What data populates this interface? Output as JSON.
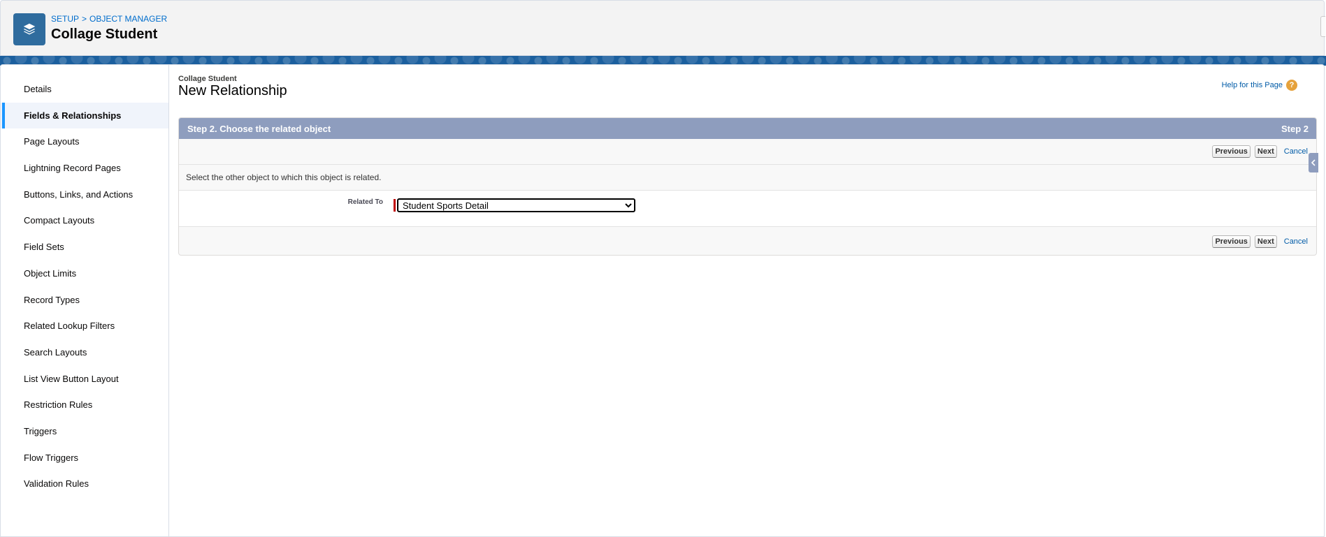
{
  "header": {
    "breadcrumb": [
      {
        "label": "SETUP"
      },
      {
        "label": "OBJECT MANAGER"
      }
    ],
    "breadcrumb_separator": ">",
    "title": "Collage Student",
    "icon": "stacked-layers-icon"
  },
  "sidebar": {
    "active_index": 1,
    "items": [
      {
        "label": "Details"
      },
      {
        "label": "Fields & Relationships"
      },
      {
        "label": "Page Layouts"
      },
      {
        "label": "Lightning Record Pages"
      },
      {
        "label": "Buttons, Links, and Actions"
      },
      {
        "label": "Compact Layouts"
      },
      {
        "label": "Field Sets"
      },
      {
        "label": "Object Limits"
      },
      {
        "label": "Record Types"
      },
      {
        "label": "Related Lookup Filters"
      },
      {
        "label": "Search Layouts"
      },
      {
        "label": "List View Button Layout"
      },
      {
        "label": "Restriction Rules"
      },
      {
        "label": "Triggers"
      },
      {
        "label": "Flow Triggers"
      },
      {
        "label": "Validation Rules"
      }
    ]
  },
  "main": {
    "object_label": "Collage Student",
    "page_title": "New Relationship",
    "help_link": "Help for this Page",
    "help_icon": "?",
    "step": {
      "title": "Step 2. Choose the related object",
      "step_indicator": "Step 2"
    },
    "buttons": {
      "previous": "Previous",
      "next": "Next",
      "cancel": "Cancel"
    },
    "instruction": "Select the other object to which this object is related.",
    "field": {
      "label": "Related To",
      "selected_value": "Student Sports Detail"
    }
  },
  "colors": {
    "accent": "#1b96ff",
    "step_header": "#8e9dbe",
    "link": "#015ba7",
    "required": "#c00000",
    "object_icon_bg": "#2f6c9e",
    "band": "#1b5f9e"
  }
}
